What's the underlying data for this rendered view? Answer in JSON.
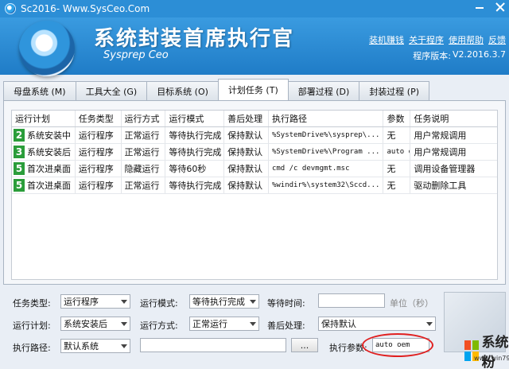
{
  "window": {
    "title": "Sc2016- Www.SysCeo.Com"
  },
  "header": {
    "app_title": "系统封装首席执行官",
    "subtitle": "Sysprep Ceo",
    "links": [
      "装机赚钱",
      "关于程序",
      "使用帮助",
      "反馈"
    ],
    "version_label": "程序版本:",
    "version_value": "V2.2016.3.7"
  },
  "tabs": [
    {
      "label": "母盘系统 (M)",
      "active": false
    },
    {
      "label": "工具大全 (G)",
      "active": false
    },
    {
      "label": "目标系统 (O)",
      "active": false
    },
    {
      "label": "计划任务 (T)",
      "active": true
    },
    {
      "label": "部署过程 (D)",
      "active": false
    },
    {
      "label": "封装过程 (P)",
      "active": false
    }
  ],
  "table": {
    "columns": [
      "运行计划",
      "任务类型",
      "运行方式",
      "运行模式",
      "善后处理",
      "执行路径",
      "参数",
      "任务说明"
    ],
    "rows": [
      {
        "num": "2",
        "plan": "系统安装中",
        "type": "运行程序",
        "method": "正常运行",
        "mode": "等待执行完成",
        "after": "保持默认",
        "path": "%SystemDrive%\\sysprep\\...",
        "param": "无",
        "desc": "用户常规调用"
      },
      {
        "num": "3",
        "plan": "系统安装后",
        "type": "运行程序",
        "method": "正常运行",
        "mode": "等待执行完成",
        "after": "保持默认",
        "path": "%SystemDrive%\\Program ...",
        "param": "auto oem",
        "desc": "用户常规调用"
      },
      {
        "num": "5",
        "plan": "首次进桌面",
        "type": "运行程序",
        "method": "隐藏运行",
        "mode": "等待60秒",
        "after": "保持默认",
        "path": "cmd /c devmgmt.msc",
        "param": "无",
        "desc": "调用设备管理器"
      },
      {
        "num": "5",
        "plan": "首次进桌面",
        "type": "运行程序",
        "method": "正常运行",
        "mode": "等待执行完成",
        "after": "保持默认",
        "path": "%windir%\\system32\\Sccd...",
        "param": "无",
        "desc": "驱动删除工具"
      }
    ]
  },
  "form": {
    "task_type_label": "任务类型:",
    "task_type_value": "运行程序",
    "run_mode_label": "运行模式:",
    "run_mode_value": "等待执行完成",
    "wait_time_label": "等待时间:",
    "wait_time_value": "",
    "wait_unit": "单位（秒）",
    "run_plan_label": "运行计划:",
    "run_plan_value": "系统安装后",
    "run_method_label": "运行方式:",
    "run_method_value": "正常运行",
    "after_label": "善后处理:",
    "after_value": "保持默认",
    "path_label": "执行路径:",
    "path_select_value": "默认系统",
    "path_value": "",
    "browse_label": "...",
    "param_label": "执行参数:",
    "param_value": "auto oem"
  },
  "watermark": {
    "text": "系统粉",
    "url": "www.win7999.com"
  },
  "colors": {
    "header": "#2c8ed6",
    "badge": "#2a9d3a",
    "highlight": "#e02020"
  }
}
